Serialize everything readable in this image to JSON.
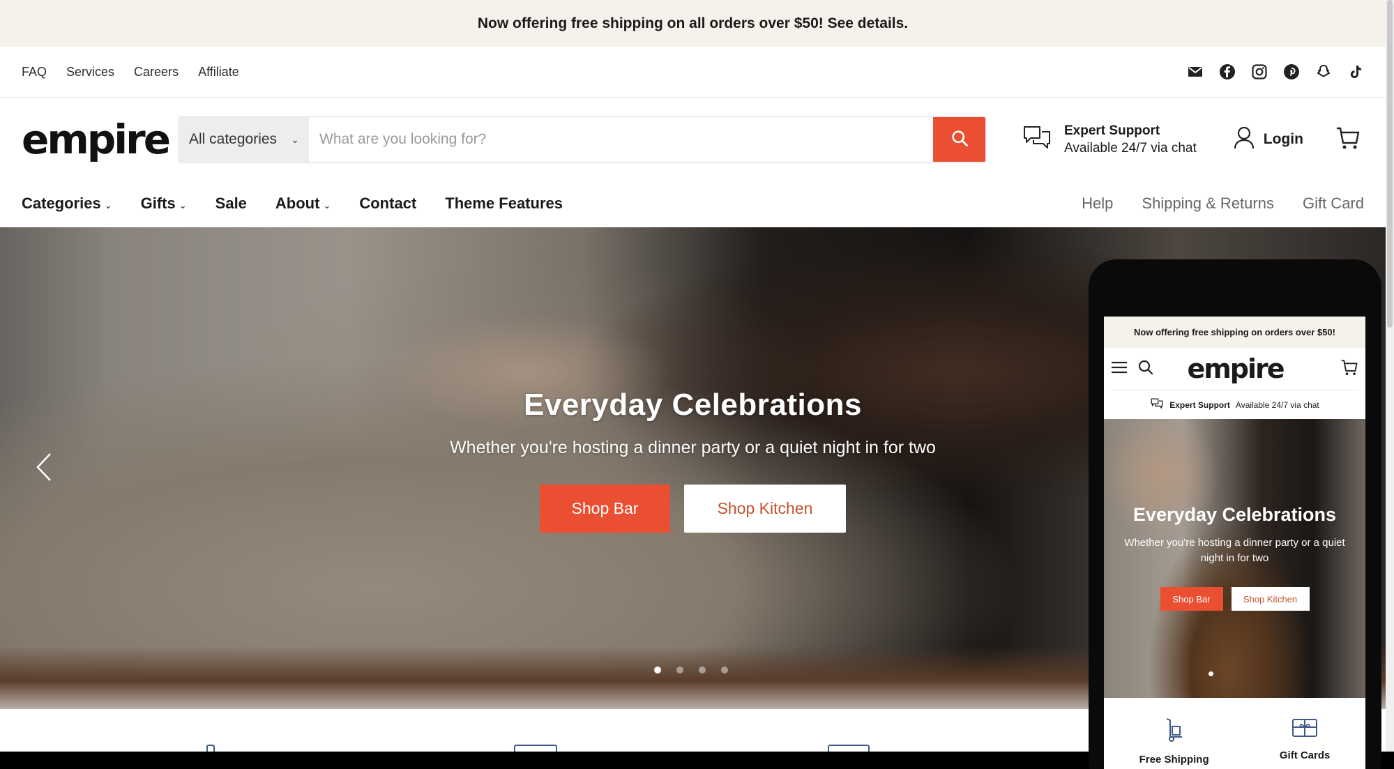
{
  "announcement": {
    "text": "Now offering free shipping on all orders over $50! See details."
  },
  "utility_nav": {
    "links": [
      {
        "label": "FAQ"
      },
      {
        "label": "Services"
      },
      {
        "label": "Careers"
      },
      {
        "label": "Affiliate"
      }
    ],
    "social_icons": [
      "mail-icon",
      "facebook-icon",
      "instagram-icon",
      "pinterest-icon",
      "snapchat-icon",
      "tiktok-icon"
    ]
  },
  "header": {
    "logo": "empire",
    "search": {
      "category": "All categories",
      "placeholder": "What are you looking for?"
    },
    "support": {
      "title": "Expert Support",
      "subtitle": "Available 24/7 via chat"
    },
    "login_label": "Login",
    "accent_color": "#eb4f32"
  },
  "main_nav": {
    "left": [
      {
        "label": "Categories",
        "dropdown": true
      },
      {
        "label": "Gifts",
        "dropdown": true
      },
      {
        "label": "Sale",
        "dropdown": false
      },
      {
        "label": "About",
        "dropdown": true
      },
      {
        "label": "Contact",
        "dropdown": false
      },
      {
        "label": "Theme Features",
        "dropdown": false
      }
    ],
    "right": [
      {
        "label": "Help"
      },
      {
        "label": "Shipping & Returns"
      },
      {
        "label": "Gift Card"
      }
    ]
  },
  "hero": {
    "title": "Everyday Celebrations",
    "subtitle": "Whether you're hosting a dinner party or a quiet night in for two",
    "primary_button": "Shop Bar",
    "secondary_button": "Shop Kitchen",
    "slide_count": 4,
    "active_slide": 1
  },
  "mobile": {
    "announcement": "Now offering free shipping on orders over $50!",
    "logo": "empire",
    "support_title": "Expert Support",
    "support_subtitle": "Available 24/7 via chat",
    "hero_title": "Everyday Celebrations",
    "hero_subtitle": "Whether you're hosting a dinner party or a quiet night in for two",
    "primary_button": "Shop Bar",
    "secondary_button": "Shop Kitchen",
    "features": [
      {
        "label": "Free Shipping",
        "icon": "hand-truck-icon"
      },
      {
        "label": "Gift Cards",
        "icon": "gift-card-icon"
      }
    ]
  }
}
